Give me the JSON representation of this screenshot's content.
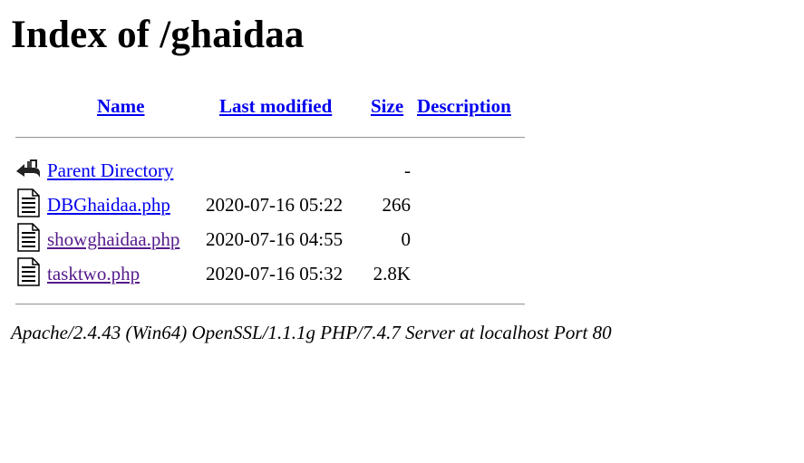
{
  "page": {
    "title": "Index of /ghaidaa"
  },
  "table": {
    "headers": {
      "name": "Name",
      "last_modified": "Last modified",
      "size": "Size",
      "description": "Description"
    },
    "rows": [
      {
        "icon": "back-icon",
        "name": "Parent Directory",
        "date": "",
        "size": "-",
        "visited": false
      },
      {
        "icon": "text-file-icon",
        "name": "DBGhaidaa.php",
        "date": "2020-07-16 05:22",
        "size": "266",
        "visited": false
      },
      {
        "icon": "text-file-icon",
        "name": "showghaidaa.php",
        "date": "2020-07-16 04:55",
        "size": "0",
        "visited": true
      },
      {
        "icon": "text-file-icon",
        "name": "tasktwo.php",
        "date": "2020-07-16 05:32",
        "size": "2.8K",
        "visited": true
      }
    ]
  },
  "footer": {
    "server_signature": "Apache/2.4.43 (Win64) OpenSSL/1.1.1g PHP/7.4.7 Server at localhost Port 80"
  },
  "colors": {
    "link": "#0000ee",
    "visited_link": "#551a8b",
    "rule": "#9a9a9a"
  }
}
